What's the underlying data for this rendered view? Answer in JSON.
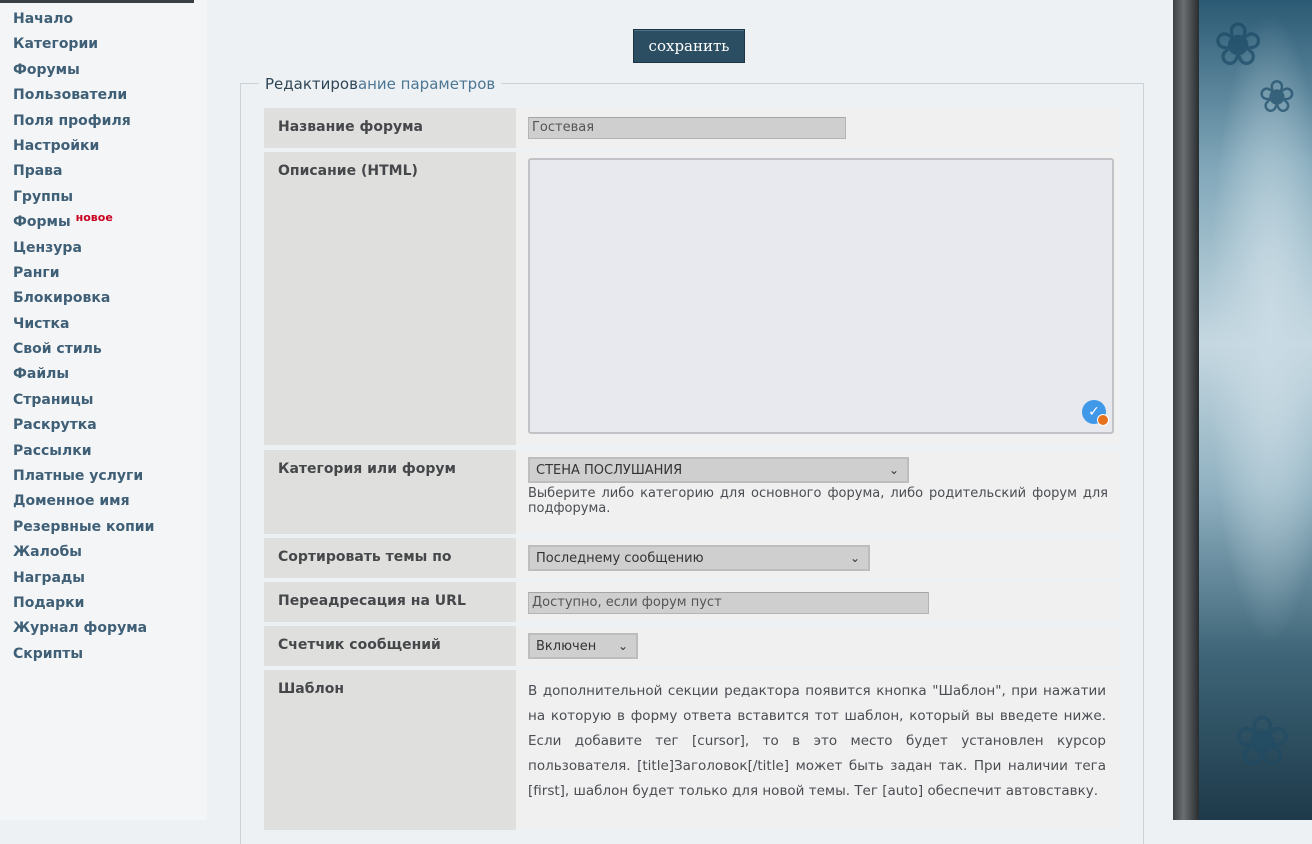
{
  "sidebar": {
    "items": [
      {
        "label": "Начало"
      },
      {
        "label": "Категории"
      },
      {
        "label": "Форумы"
      },
      {
        "label": "Пользователи"
      },
      {
        "label": "Поля профиля"
      },
      {
        "label": "Настройки"
      },
      {
        "label": "Права"
      },
      {
        "label": "Группы"
      },
      {
        "label": "Формы",
        "badge": "новое"
      },
      {
        "label": "Цензура"
      },
      {
        "label": "Ранги"
      },
      {
        "label": "Блокировка"
      },
      {
        "label": "Чистка"
      },
      {
        "label": "Свой стиль"
      },
      {
        "label": "Файлы"
      },
      {
        "label": "Страницы"
      },
      {
        "label": "Раскрутка"
      },
      {
        "label": "Рассылки"
      },
      {
        "label": "Платные услуги"
      },
      {
        "label": "Доменное имя"
      },
      {
        "label": "Резервные копии"
      },
      {
        "label": "Жалобы"
      },
      {
        "label": "Награды"
      },
      {
        "label": "Подарки"
      },
      {
        "label": "Журнал форума"
      },
      {
        "label": "Скрипты"
      }
    ]
  },
  "toolbar": {
    "save_label": "сохранить"
  },
  "form": {
    "legend_part1": "Редактиров",
    "legend_part2": "ание параметров",
    "forum_name": {
      "label": "Название форума",
      "value": "Гостевая"
    },
    "description": {
      "label": "Описание (HTML)",
      "value": ""
    },
    "category": {
      "label": "Категория или форум",
      "selected": "СТЕНА ПОСЛУШАНИЯ",
      "help": "Выберите либо категорию для основного форума, либо родительский форум для подфорума."
    },
    "sort": {
      "label": "Сортировать темы по",
      "selected": "Последнему сообщению"
    },
    "redirect": {
      "label": "Переадресация на URL",
      "placeholder": "Доступно, если форум пуст"
    },
    "counter": {
      "label": "Счетчик сообщений",
      "selected": "Включен"
    },
    "template": {
      "label": "Шаблон",
      "help": "В дополнительной секции редактора появится кнопка \"Шаблон\", при нажатии на которую в форму ответа вставится тот шаблон, который вы введете ниже. Если добавите тег [cursor], то в это место будет установлен курсор пользователя. [title]Заголовок[/title] может быть задан так. При наличии тега [first], шаблон будет только для новой темы. Тег [auto] обеспечит автовставку."
    }
  },
  "colors": {
    "accent": "#2c4e62",
    "sidebar_text": "#3f5f77",
    "badge": "#c8001e"
  },
  "icons": {
    "textarea_check": "check-circle-icon",
    "chevron": "chevron-down-icon"
  }
}
